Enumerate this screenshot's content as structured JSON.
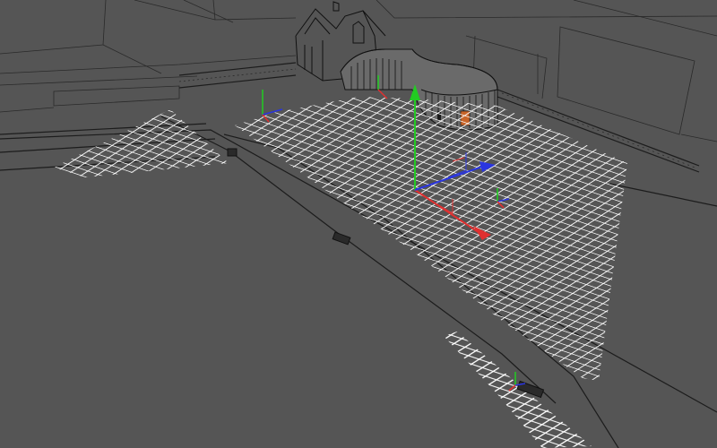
{
  "viewport": {
    "background": "#555555",
    "wire_color": "#1c1c1c",
    "grid_color": "#ffffff"
  },
  "gizmos": [
    {
      "name": "main-transform-gizmo",
      "axes": [
        "x-red",
        "y-green",
        "z-blue"
      ]
    },
    {
      "name": "secondary-transform-gizmo",
      "axes": [
        "x-red",
        "y-green",
        "z-blue"
      ]
    }
  ],
  "axis_colors": {
    "x": "#e03030",
    "y": "#22cc22",
    "z": "#2a35e0"
  }
}
